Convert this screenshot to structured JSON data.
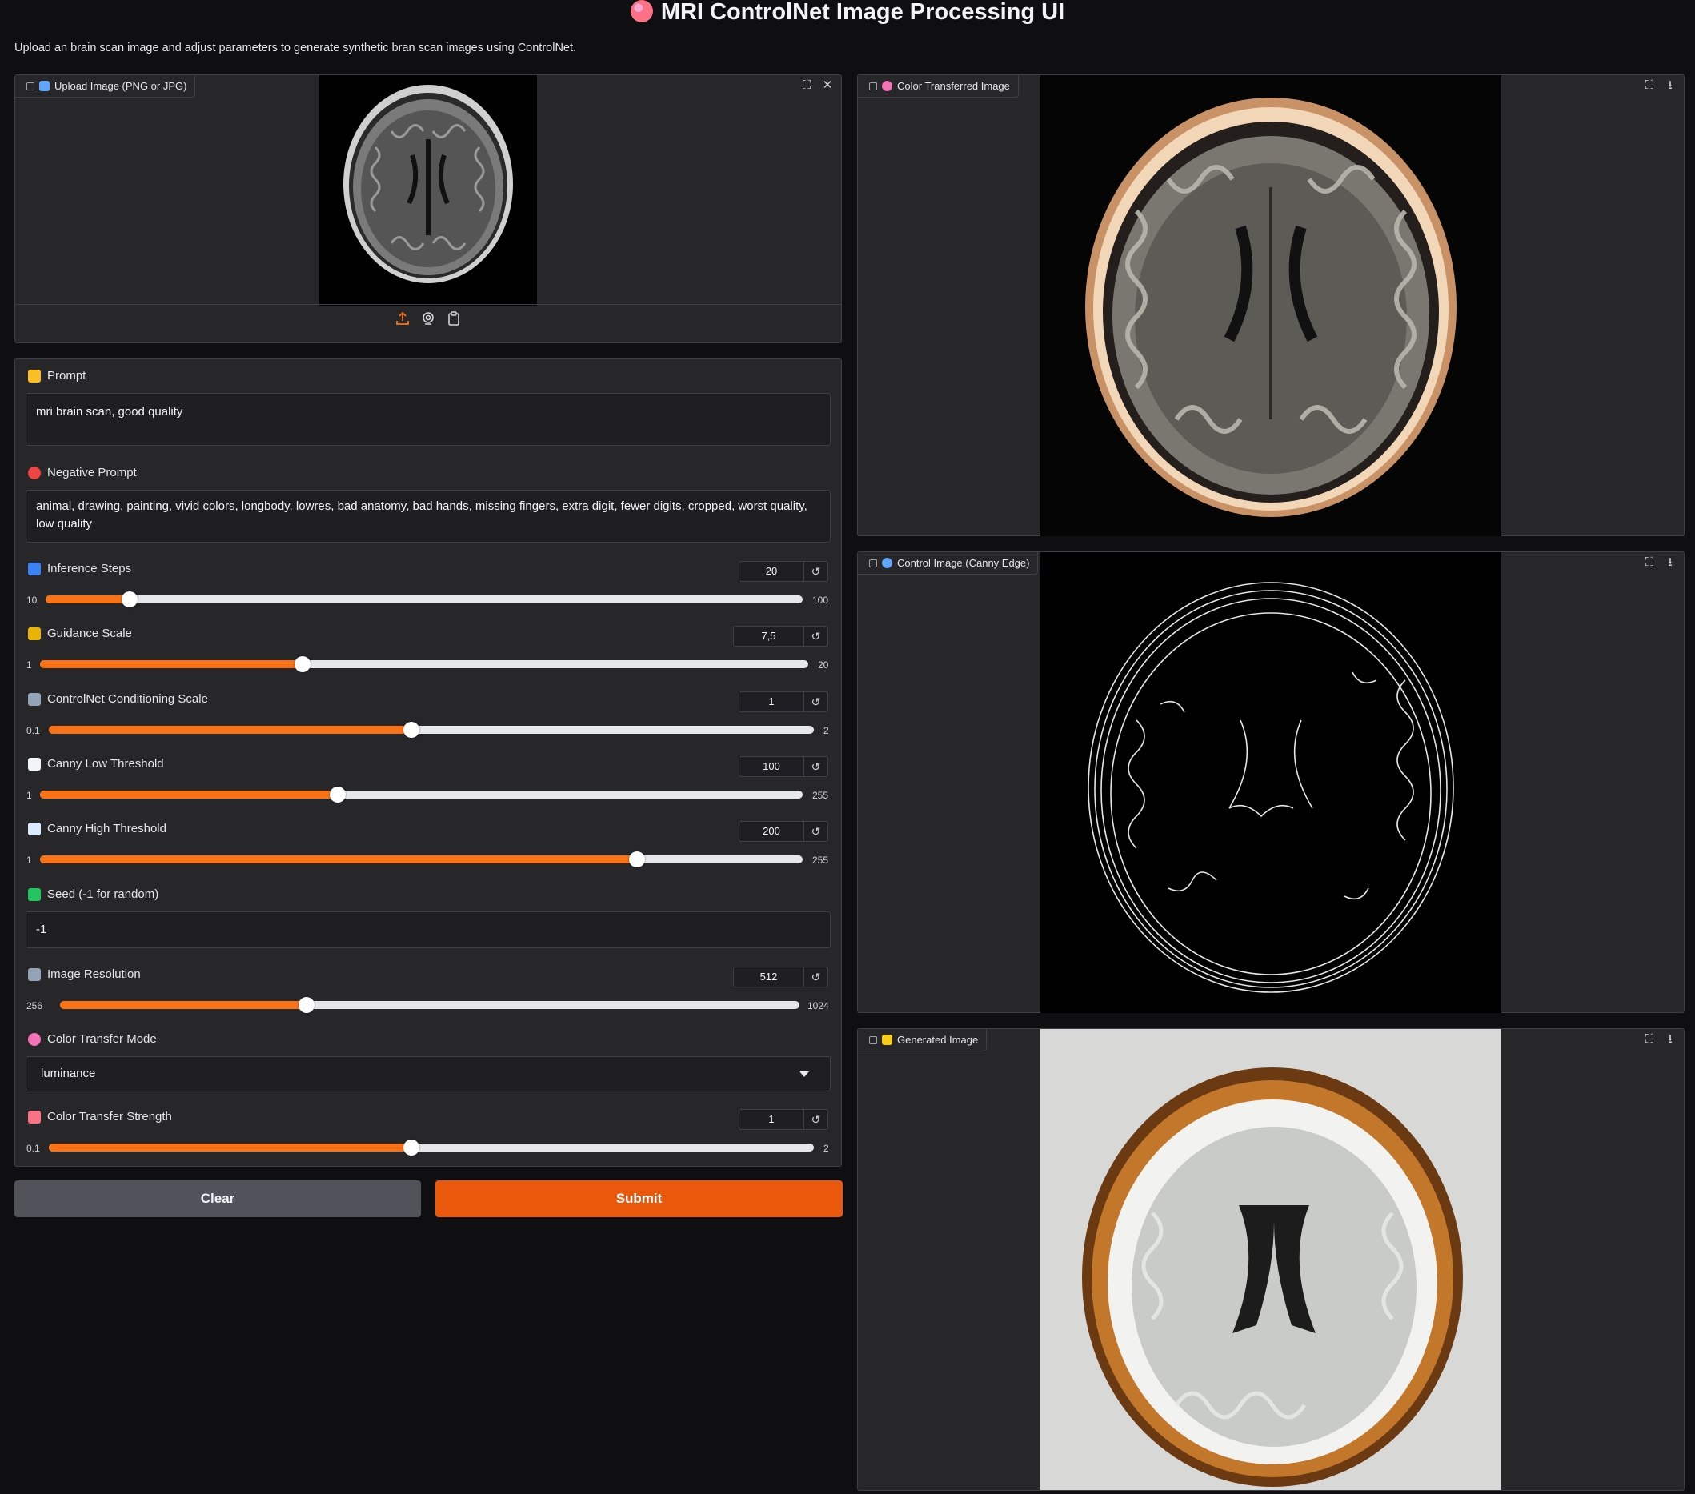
{
  "header": {
    "title": "MRI ControlNet Image Processing UI",
    "subtitle": "Upload an brain scan image and adjust parameters to generate synthetic bran scan images using ControlNet."
  },
  "upload_panel": {
    "label": "Upload Image (PNG or JPG)"
  },
  "outputs": {
    "color_transferred": {
      "label": "Color Transferred Image"
    },
    "control": {
      "label": "Control Image (Canny Edge)"
    },
    "generated": {
      "label": "Generated Image"
    }
  },
  "form": {
    "prompt": {
      "label": "Prompt",
      "value": "mri brain scan, good quality"
    },
    "negative_prompt": {
      "label": "Negative Prompt",
      "value": "animal, drawing, painting, vivid colors, longbody, lowres, bad anatomy, bad hands, missing fingers, extra digit, fewer digits, cropped, worst quality, low quality"
    },
    "inference_steps": {
      "label": "Inference Steps",
      "value": "20",
      "min": "10",
      "max": "100",
      "fraction": 0.111
    },
    "guidance_scale": {
      "label": "Guidance Scale",
      "value": "7,5",
      "min": "1",
      "max": "20",
      "fraction": 0.342
    },
    "controlnet_scale": {
      "label": "ControlNet Conditioning Scale",
      "value": "1",
      "min": "0.1",
      "max": "2",
      "fraction": 0.474
    },
    "canny_low": {
      "label": "Canny Low Threshold",
      "value": "100",
      "min": "1",
      "max": "255",
      "fraction": 0.39
    },
    "canny_high": {
      "label": "Canny High Threshold",
      "value": "200",
      "min": "1",
      "max": "255",
      "fraction": 0.783
    },
    "seed": {
      "label": "Seed (-1 for random)",
      "value": "-1"
    },
    "image_resolution": {
      "label": "Image Resolution",
      "value": "512",
      "min": "256",
      "max": "1024",
      "fraction": 0.333
    },
    "color_transfer_mode": {
      "label": "Color Transfer Mode",
      "value": "luminance"
    },
    "color_transfer_strength": {
      "label": "Color Transfer Strength",
      "value": "1",
      "min": "0.1",
      "max": "2",
      "fraction": 0.474
    }
  },
  "actions": {
    "clear_label": "Clear",
    "submit_label": "Submit"
  },
  "colors": {
    "accent": "#f97316",
    "submit": "#ea580c",
    "background": "#0f0f11",
    "panel": "#27272a"
  }
}
